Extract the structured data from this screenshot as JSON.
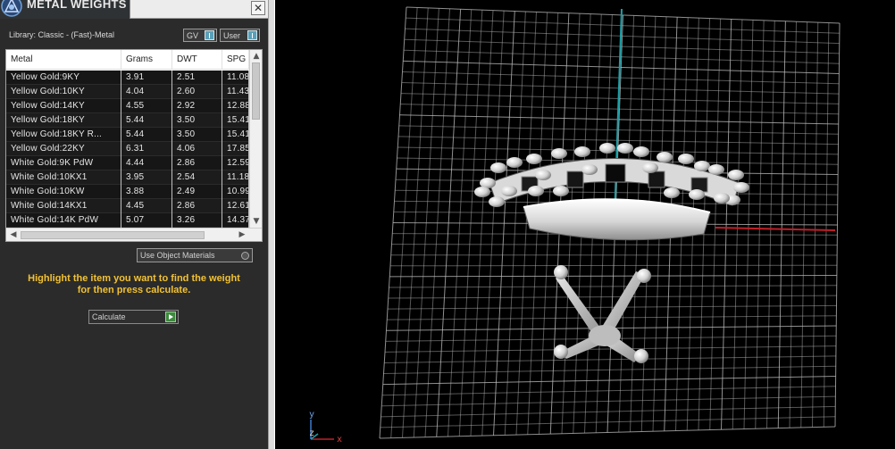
{
  "window": {
    "title": "METAL WEIGHTS",
    "close_glyph": "✕"
  },
  "library_label": "Library: Classic - (Fast)-Metal",
  "toggles": {
    "gv": "GV",
    "user": "User"
  },
  "table": {
    "headers": [
      "Metal",
      "Grams",
      "DWT",
      "SPG"
    ],
    "rows": [
      [
        "Yellow Gold:9KY",
        "3.91",
        "2.51",
        "11.08"
      ],
      [
        "Yellow Gold:10KY",
        "4.04",
        "2.60",
        "11.43"
      ],
      [
        "Yellow Gold:14KY",
        "4.55",
        "2.92",
        "12.88"
      ],
      [
        "Yellow Gold:18KY",
        "5.44",
        "3.50",
        "15.41"
      ],
      [
        "Yellow Gold:18KY R...",
        "5.44",
        "3.50",
        "15.41"
      ],
      [
        "Yellow Gold:22KY",
        "6.31",
        "4.06",
        "17.85"
      ],
      [
        "White Gold:9K PdW",
        "4.44",
        "2.86",
        "12.59"
      ],
      [
        "White Gold:10KX1",
        "3.95",
        "2.54",
        "11.18"
      ],
      [
        "White Gold:10KW",
        "3.88",
        "2.49",
        "10.99"
      ],
      [
        "White Gold:14KX1",
        "4.45",
        "2.86",
        "12.61"
      ],
      [
        "White Gold:14K PdW",
        "5.07",
        "3.26",
        "14.37"
      ]
    ]
  },
  "use_object_materials": "Use Object Materials",
  "hint": [
    "Highlight the item you want to find the weight",
    "for then press calculate."
  ],
  "calculate_label": "Calculate",
  "viewport": {
    "axis": {
      "y": "y",
      "z": "z",
      "x": "x"
    }
  },
  "colors": {
    "hint": "#f2c232",
    "axis_red": "#c0202a",
    "axis_cyan": "#1aa0a8",
    "grid": "#bfbfbf"
  }
}
